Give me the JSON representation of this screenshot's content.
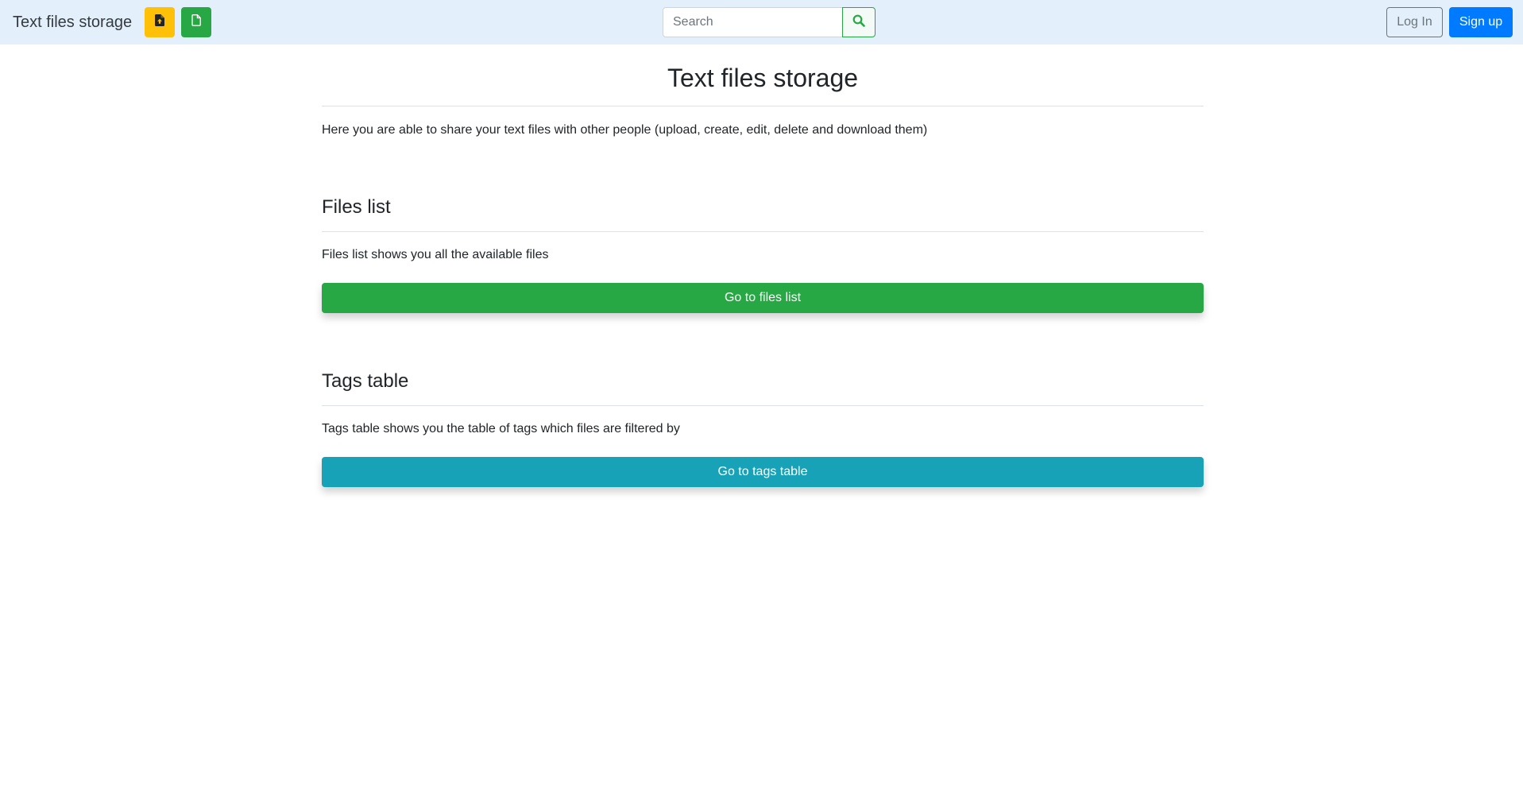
{
  "navbar": {
    "brand": "Text files storage",
    "upload_icon": "file-upload-icon",
    "new_file_icon": "file-icon",
    "search": {
      "placeholder": "Search",
      "value": "",
      "icon": "search-icon"
    },
    "login_label": "Log In",
    "signup_label": "Sign up"
  },
  "main": {
    "title": "Text files storage",
    "intro": "Here you are able to share your text files with other people (upload, create, edit, delete and download them)",
    "sections": [
      {
        "title": "Files list",
        "description": "Files list shows you all the available files",
        "button_label": "Go to files list"
      },
      {
        "title": "Tags table",
        "description": "Tags table shows you the table of tags which files are filtered by",
        "button_label": "Go to tags table"
      }
    ]
  },
  "colors": {
    "navbar_bg": "#e3f0fb",
    "warning": "#ffc107",
    "success": "#28a745",
    "info": "#17a2b8",
    "primary": "#007bff",
    "secondary": "#6c757d"
  }
}
